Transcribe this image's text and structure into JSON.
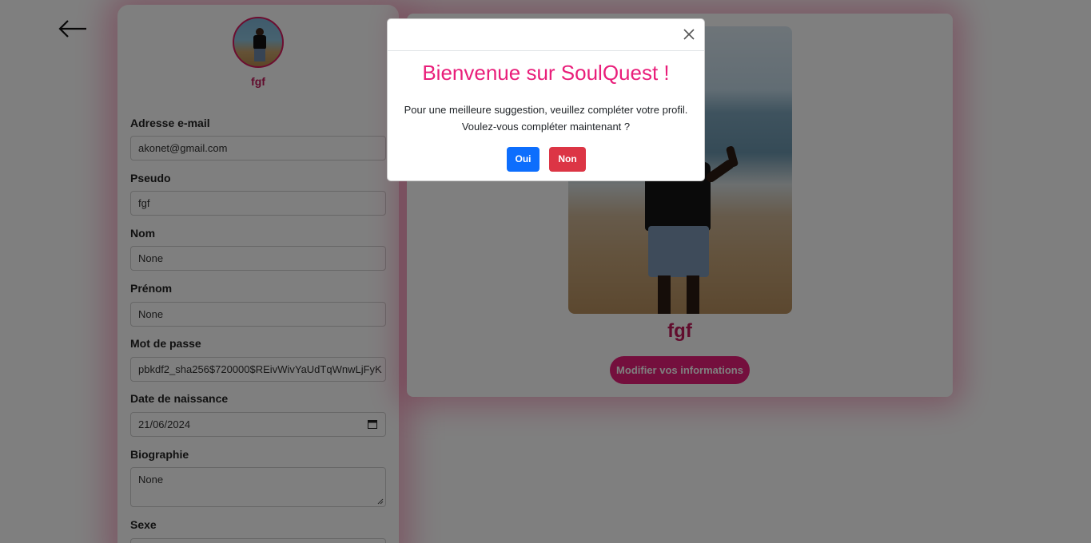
{
  "nav": {
    "back_icon": "arrow-left-icon"
  },
  "avatar": {
    "name": "fgf"
  },
  "form": {
    "email": {
      "label": "Adresse e-mail",
      "value": "akonet@gmail.com"
    },
    "pseudo": {
      "label": "Pseudo",
      "value": "fgf"
    },
    "nom": {
      "label": "Nom",
      "value": "None"
    },
    "prenom": {
      "label": "Prénom",
      "value": "None"
    },
    "password": {
      "label": "Mot de passe",
      "value": "pbkdf2_sha256$720000$REivWivYaUdTqWnwLjFyK"
    },
    "birthdate": {
      "label": "Date de naissance",
      "value": "21/06/2024"
    },
    "biography": {
      "label": "Biographie",
      "value": "None"
    },
    "sexe": {
      "label": "Sexe"
    }
  },
  "profile": {
    "name": "fgf",
    "edit_label": "Modifier vos informations"
  },
  "modal": {
    "title": "Bienvenue sur SoulQuest !",
    "line1": "Pour une meilleure suggestion, veuillez compléter votre profil.",
    "line2": "Voulez-vous compléter maintenant ?",
    "yes_label": "Oui",
    "no_label": "Non"
  },
  "colors": {
    "accent": "#e91e7a",
    "accent_dark": "#c2185b",
    "primary": "#0d6efd",
    "danger": "#dc3545"
  }
}
